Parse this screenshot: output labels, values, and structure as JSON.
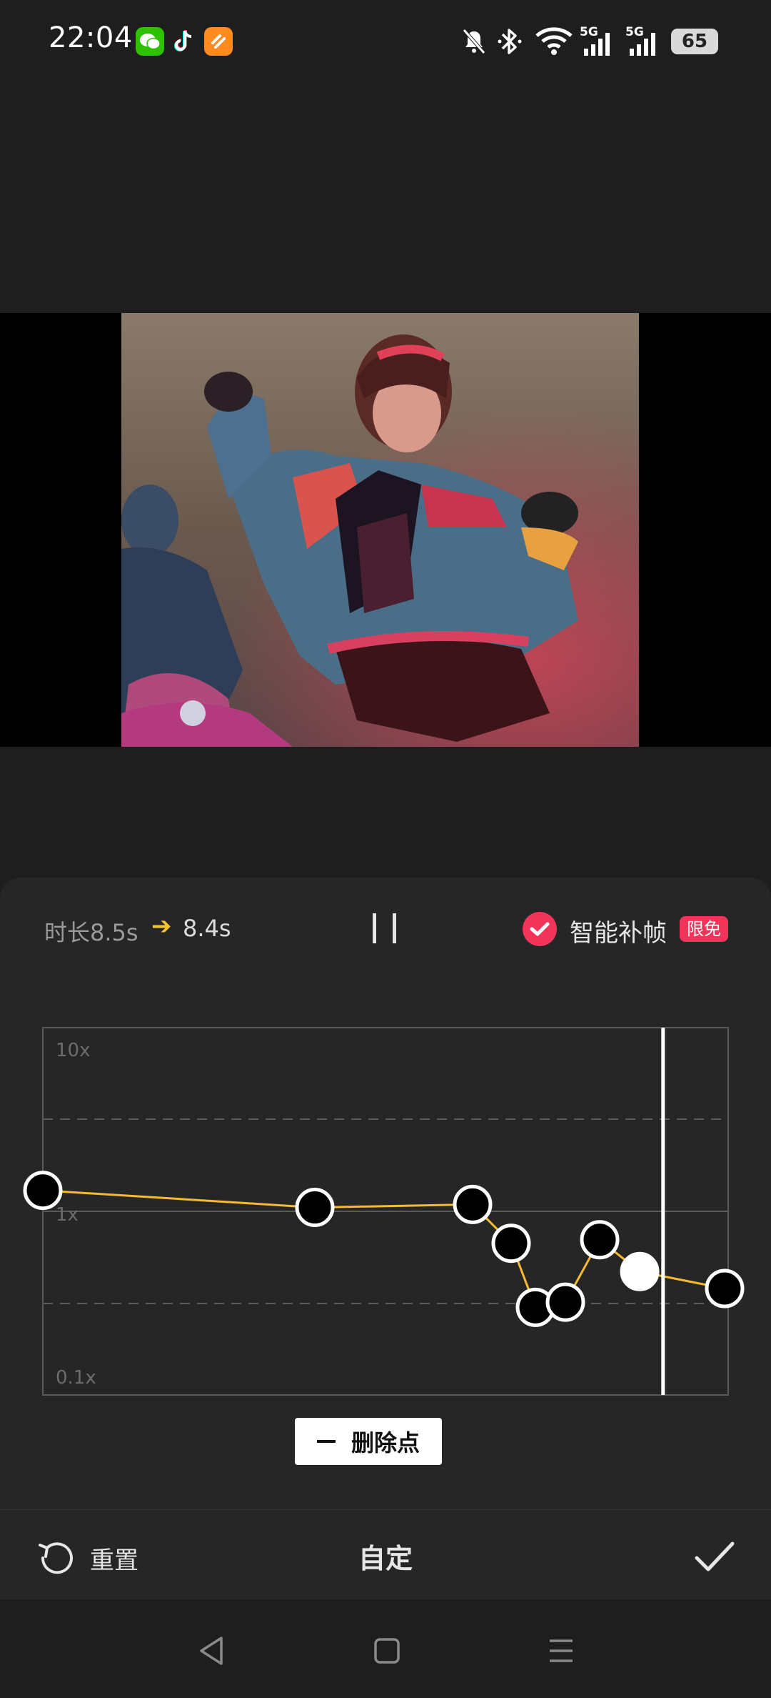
{
  "status_bar": {
    "time": "22:04",
    "apps": [
      "wechat-icon",
      "tiktok-icon",
      "orange-app-icon"
    ],
    "indicators": [
      "mute-icon",
      "bluetooth-icon",
      "wifi-icon",
      "5g-signal-icon",
      "5g-signal-icon"
    ],
    "battery": "65"
  },
  "speed_panel": {
    "duration_label": "时长8.5s",
    "duration_arrow": "➔",
    "duration_new": "8.4s",
    "smart_frame_label": "智能补帧",
    "smart_frame_checked": true,
    "free_badge": "限免",
    "graph": {
      "y_top_label": "10x",
      "y_mid_label": "1x",
      "y_bottom_label": "0.1x",
      "line_color": "#f5b932",
      "playhead_position": 0.905,
      "speed_points": [
        1.3,
        1.05,
        1.09,
        0.67,
        0.3,
        0.32,
        0.7,
        0.47,
        0.38
      ],
      "selected_point": 7
    },
    "delete_button": "删除点"
  },
  "toolbar": {
    "reset_label": "重置",
    "title": "自定",
    "confirm_icon": "check-icon"
  },
  "nav_bar": [
    "back-icon",
    "home-icon",
    "menu-icon"
  ],
  "colors": {
    "accent_pink": "#f2335a",
    "accent_yellow": "#f5c431",
    "panel_bg": "#262626",
    "page_bg": "#1e1e1e"
  }
}
